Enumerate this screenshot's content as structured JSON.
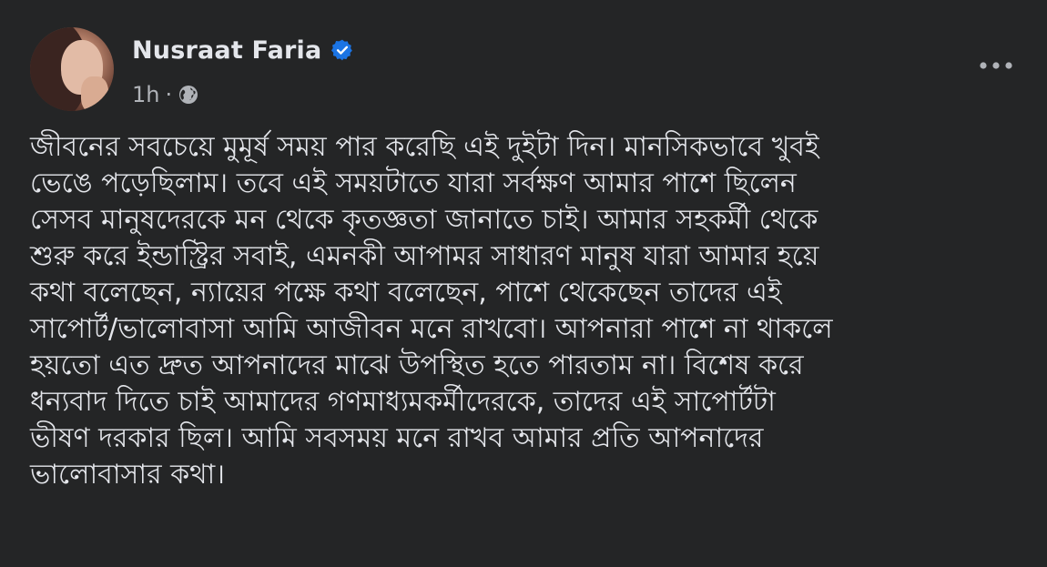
{
  "post": {
    "author": {
      "name": "Nusraat Faria",
      "verified": true,
      "avatar_icon": "profile-photo"
    },
    "meta": {
      "timestamp": "1h",
      "separator": "·",
      "audience_icon": "globe-icon"
    },
    "more_icon": "more-horizontal-icon",
    "text": "জীবনের সবচেয়ে মুমূর্ষ সময় পার করেছি এই দুইটা দিন। মানসিকভাবে খুবই\nভেঙে পড়েছিলাম। তবে এই সময়টাতে যারা সর্বক্ষণ আমার পাশে ছিলেন\nসেসব মানুষদেরকে মন থেকে কৃতজ্ঞতা জানাতে চাই। আমার সহকর্মী থেকে\nশুরু করে ইন্ডাস্ট্রির সবাই, এমনকী আপামর সাধারণ মানুষ যারা আমার হয়ে\nকথা বলেছেন, ন্যায়ের পক্ষে কথা বলেছেন, পাশে থেকেছেন তাদের এই\nসাপোর্ট/ভালোবাসা আমি আজীবন মনে রাখবো। আপনারা পাশে না থাকলে\nহয়তো এত দ্রুত আপনাদের মাঝে উপস্থিত হতে পারতাম না। বিশেষ করে\nধন্যবাদ দিতে চাই আমাদের গণমাধ্যমকর্মীদেরকে, তাদের এই সাপোর্টটা\nভীষণ দরকার ছিল। আমি সবসময় মনে রাখব আমার প্রতি আপনাদের\nভালোবাসার কথা।"
  },
  "colors": {
    "background": "#242526",
    "primary_text": "#e4e6eb",
    "secondary_text": "#b0b3b8",
    "verified_badge": "#1b74e4"
  }
}
